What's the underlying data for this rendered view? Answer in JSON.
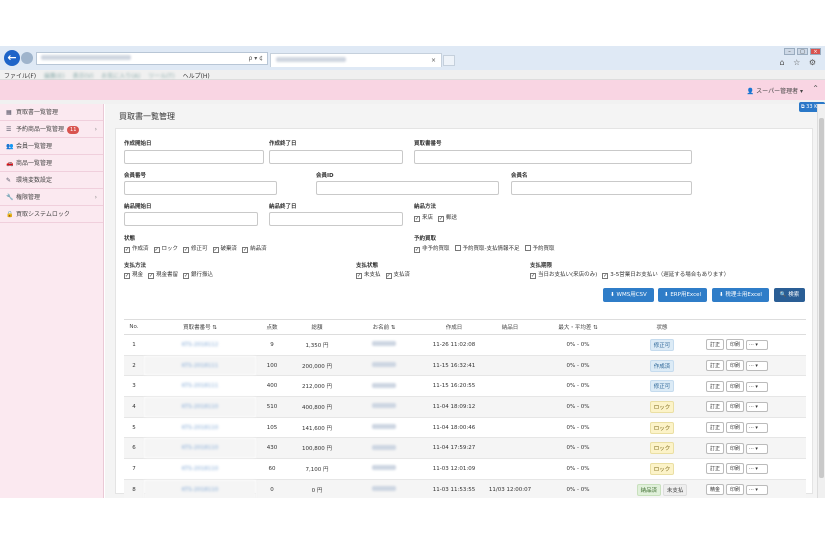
{
  "browser": {
    "address_text": "",
    "address_controls": "ρ ▾ ¢",
    "tab_label": "",
    "tab_close": "×",
    "win_min": "–",
    "win_max": "□",
    "win_close": "×",
    "tools": "⌂ ☆ ⚙",
    "menu": [
      "ファイル(F)",
      "編集(E)",
      "表示(V)",
      "お気に入り(A)",
      "ツール(T)",
      "ヘルプ(H)"
    ]
  },
  "header": {
    "user_label": "スーパー管理者 ▾",
    "corner_button": "33 KB"
  },
  "sidebar": {
    "items": [
      {
        "icon": "▦",
        "label": "買取書一覧管理",
        "badge": "",
        "arrow": ""
      },
      {
        "icon": "☰",
        "label": "予約商品一覧管理",
        "badge": "11",
        "arrow": "›"
      },
      {
        "icon": "👥",
        "label": "会員一覧管理",
        "badge": "",
        "arrow": ""
      },
      {
        "icon": "🚗",
        "label": "商品一覧管理",
        "badge": "",
        "arrow": ""
      },
      {
        "icon": "✎",
        "label": "環境変数設定",
        "badge": "",
        "arrow": ""
      },
      {
        "icon": "🔧",
        "label": "権限管理",
        "badge": "",
        "arrow": "›"
      },
      {
        "icon": "🔒",
        "label": "買取システムロック",
        "badge": "",
        "arrow": ""
      }
    ]
  },
  "page": {
    "title": "買取書一覧管理"
  },
  "filters": {
    "labels": {
      "create_start": "作成開始日",
      "create_end": "作成終了日",
      "purchase_no": "買取書番号",
      "member_no": "会員番号",
      "member_id": "会員ID",
      "member_name": "会員名",
      "delivery_start": "納品開始日",
      "delivery_end": "納品終了日",
      "delivery_method": "納品方法",
      "status": "状態",
      "reservation": "予約買取",
      "payment_method": "支払方法",
      "payment_status": "支払状態",
      "payment_deadline": "支払期限"
    },
    "delivery_method_opts": [
      "来店",
      "郵送"
    ],
    "status_opts": [
      "作成済",
      "ロック",
      "修正可",
      "破棄済",
      "納品済"
    ],
    "reservation_opts": [
      "非予約買取",
      "予約買取-支払情報不足",
      "予約買取"
    ],
    "payment_method_opts": [
      "現金",
      "現金書留",
      "銀行振込"
    ],
    "payment_status_opts": [
      "未支払",
      "支払済"
    ],
    "payment_deadline_opts": [
      "当日お支払い(来店のみ)",
      "3-5営業日お支払い（遅延する場合もあります）"
    ]
  },
  "buttons": {
    "wms_csv": "⬇ WMS用CSV",
    "erp_excel": "⬇ ERP用Excel",
    "tax_excel": "⬇ 税理士用Excel",
    "search": "🔍 検索"
  },
  "table": {
    "headers": [
      "No.",
      "買取書番号 ⇅",
      "点数",
      "総額",
      "お名前 ⇅",
      "作成日",
      "納品日",
      "最大・平均差 ⇅",
      "状態",
      ""
    ],
    "rows": [
      {
        "no": "1",
        "code": "KTS-2018112",
        "qty": "9",
        "total": "1,350 円",
        "name": "",
        "created": "11-26 11:02:08",
        "delivered": "",
        "diff": "0% - 0%",
        "status": [
          "修正可"
        ],
        "status_color": [
          "blue"
        ],
        "actions": [
          "訂正",
          "印刷"
        ]
      },
      {
        "no": "2",
        "code": "KTS-2018111",
        "qty": "100",
        "total": "200,000 円",
        "name": "",
        "created": "11-15 16:32:41",
        "delivered": "",
        "diff": "0% - 0%",
        "status": [
          "作成済"
        ],
        "status_color": [
          "blue"
        ],
        "actions": [
          "訂正",
          "印刷"
        ]
      },
      {
        "no": "3",
        "code": "KTS-2018111",
        "qty": "400",
        "total": "212,000 円",
        "name": "",
        "created": "11-15 16:20:55",
        "delivered": "",
        "diff": "0% - 0%",
        "status": [
          "修正可"
        ],
        "status_color": [
          "blue"
        ],
        "actions": [
          "訂正",
          "印刷"
        ]
      },
      {
        "no": "4",
        "code": "KTS-2018110",
        "qty": "510",
        "total": "400,800 円",
        "name": "",
        "created": "11-04 18:09:12",
        "delivered": "",
        "diff": "0% - 0%",
        "status": [
          "ロック"
        ],
        "status_color": [
          "yellow"
        ],
        "actions": [
          "訂正",
          "印刷"
        ]
      },
      {
        "no": "5",
        "code": "KTS-2018110",
        "qty": "105",
        "total": "141,600 円",
        "name": "",
        "created": "11-04 18:00:46",
        "delivered": "",
        "diff": "0% - 0%",
        "status": [
          "ロック"
        ],
        "status_color": [
          "yellow"
        ],
        "actions": [
          "訂正",
          "印刷"
        ]
      },
      {
        "no": "6",
        "code": "KTS-2018110",
        "qty": "430",
        "total": "100,800 円",
        "name": "",
        "created": "11-04 17:59:27",
        "delivered": "",
        "diff": "0% - 0%",
        "status": [
          "ロック"
        ],
        "status_color": [
          "yellow"
        ],
        "actions": [
          "訂正",
          "印刷"
        ]
      },
      {
        "no": "7",
        "code": "KTS-2018110",
        "qty": "60",
        "total": "7,100 円",
        "name": "",
        "created": "11-03 12:01:09",
        "delivered": "",
        "diff": "0% - 0%",
        "status": [
          "ロック"
        ],
        "status_color": [
          "yellow"
        ],
        "actions": [
          "訂正",
          "印刷"
        ]
      },
      {
        "no": "8",
        "code": "KTS-2018110",
        "qty": "0",
        "total": "0 円",
        "name": "",
        "created": "11-03 11:53:55",
        "delivered": "11/03 12:00:07",
        "diff": "0% - 0%",
        "status": [
          "納品済",
          "未支払"
        ],
        "status_color": [
          "green",
          "gray"
        ],
        "actions": [
          "精金",
          "印刷"
        ]
      }
    ],
    "more_label": "··· ▾"
  }
}
